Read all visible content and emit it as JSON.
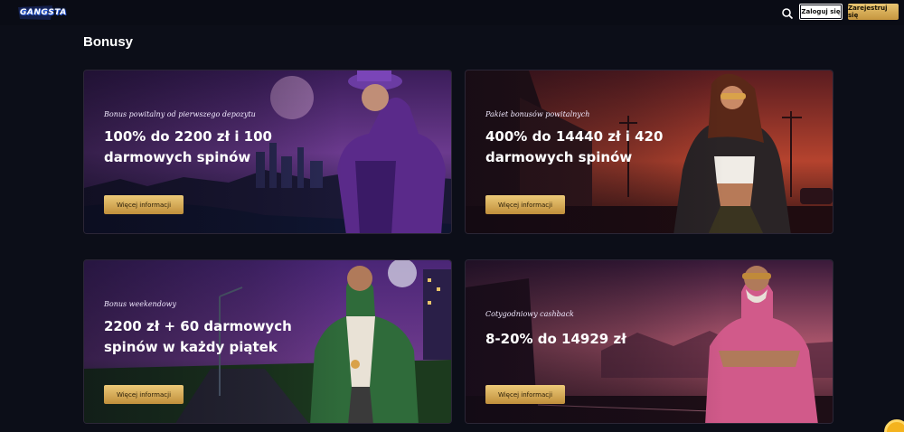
{
  "header": {
    "logo_text": "GANGSTA",
    "login_label": "Zaloguj się",
    "register_label": "Zarejestruj się"
  },
  "page": {
    "title": "Bonusy"
  },
  "cards": [
    {
      "eyebrow": "Bonus powitalny od pierwszego depozytu",
      "title": "100% do 2200 zł i 100 darmowych spinów",
      "button": "Więcej informacji"
    },
    {
      "eyebrow": "Pakiet bonusów powitalnych",
      "title": "400% do 14440 zł i 420 darmowych spinów",
      "button": "Więcej informacji"
    },
    {
      "eyebrow": "Bonus weekendowy",
      "title": "2200 zł + 60 darmowych spinów w każdy piątek",
      "button": "Więcej informacji"
    },
    {
      "eyebrow": "Cotygodniowy cashback",
      "title": "8-20% do 14929 zł",
      "button": "Więcej informacji"
    }
  ],
  "colors": {
    "background": "#0c0e18",
    "gold": "#d9ad55",
    "accent_chat": "#f4b31e"
  },
  "icons": [
    "search-icon",
    "chat-icon"
  ]
}
